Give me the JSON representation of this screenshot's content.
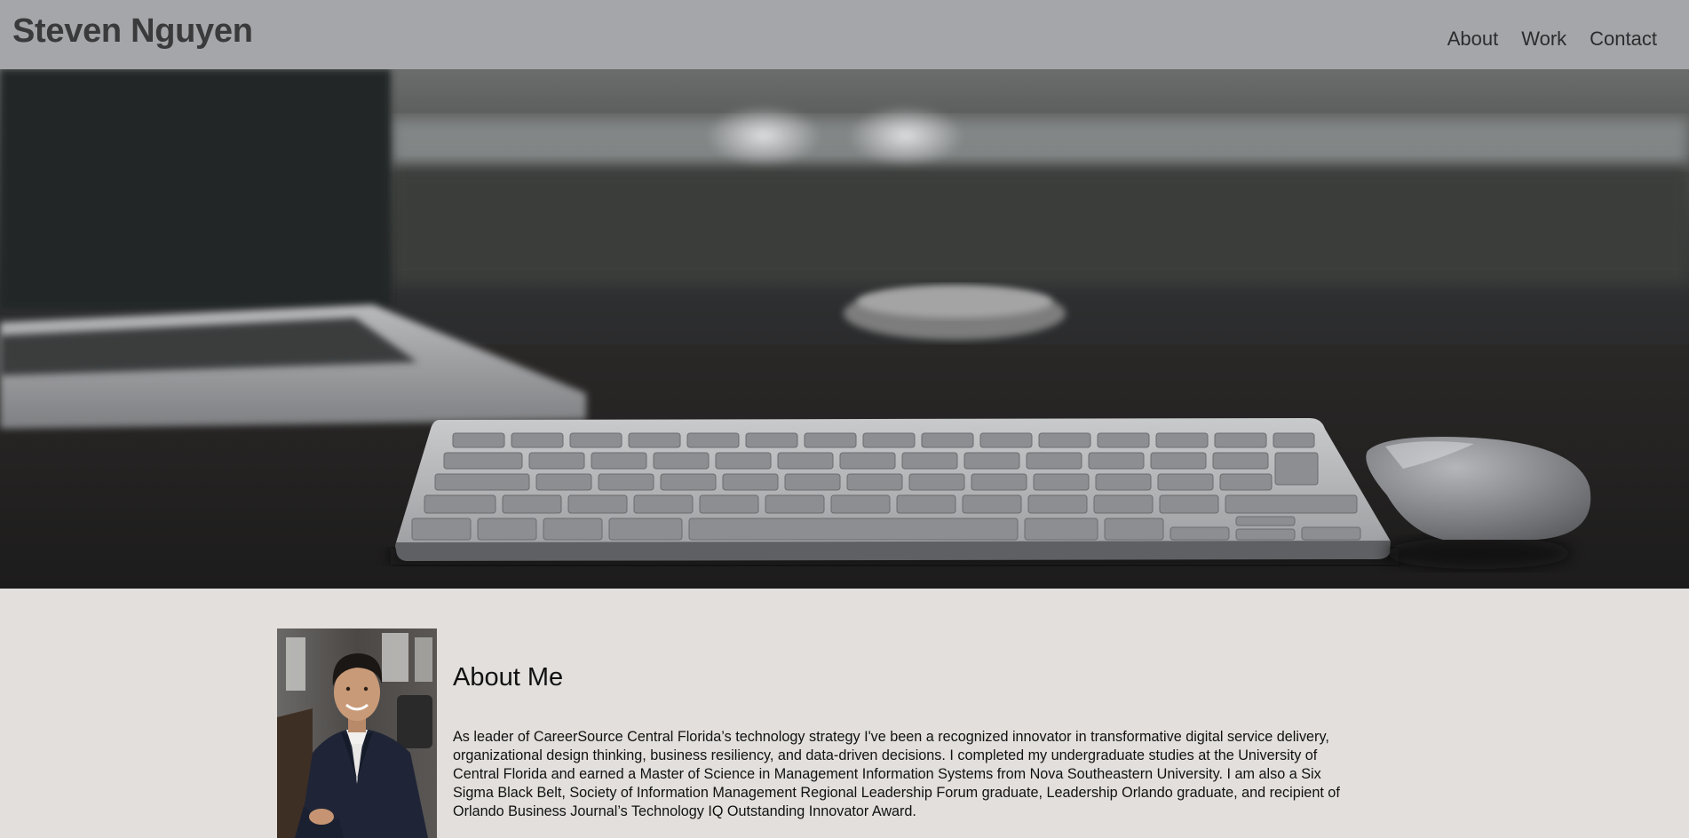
{
  "header": {
    "title": "Steven Nguyen",
    "nav": [
      "About",
      "Work",
      "Contact"
    ]
  },
  "hero": {
    "image": "desk-workspace-photo"
  },
  "about": {
    "portrait": "profile-photo",
    "heading": "About Me",
    "body": "As leader of CareerSource Central Florida’s technology strategy I've been a recognized innovator in transformative digital service delivery, organizational design thinking, business resiliency, and data-driven decisions. I completed my undergraduate studies at the University of Central Florida and earned a Master of Science in Management Information Systems from Nova Southeastern University. I am also a Six Sigma Black Belt, Society of Information Management Regional Leadership Forum graduate, Leadership Orlando graduate, and recipient of Orlando Business Journal’s Technology IQ Outstanding Innovator Award."
  },
  "colors": {
    "header_bg": "#a5a6a9",
    "page_bg": "#e2dfdc",
    "text": "#111111"
  }
}
